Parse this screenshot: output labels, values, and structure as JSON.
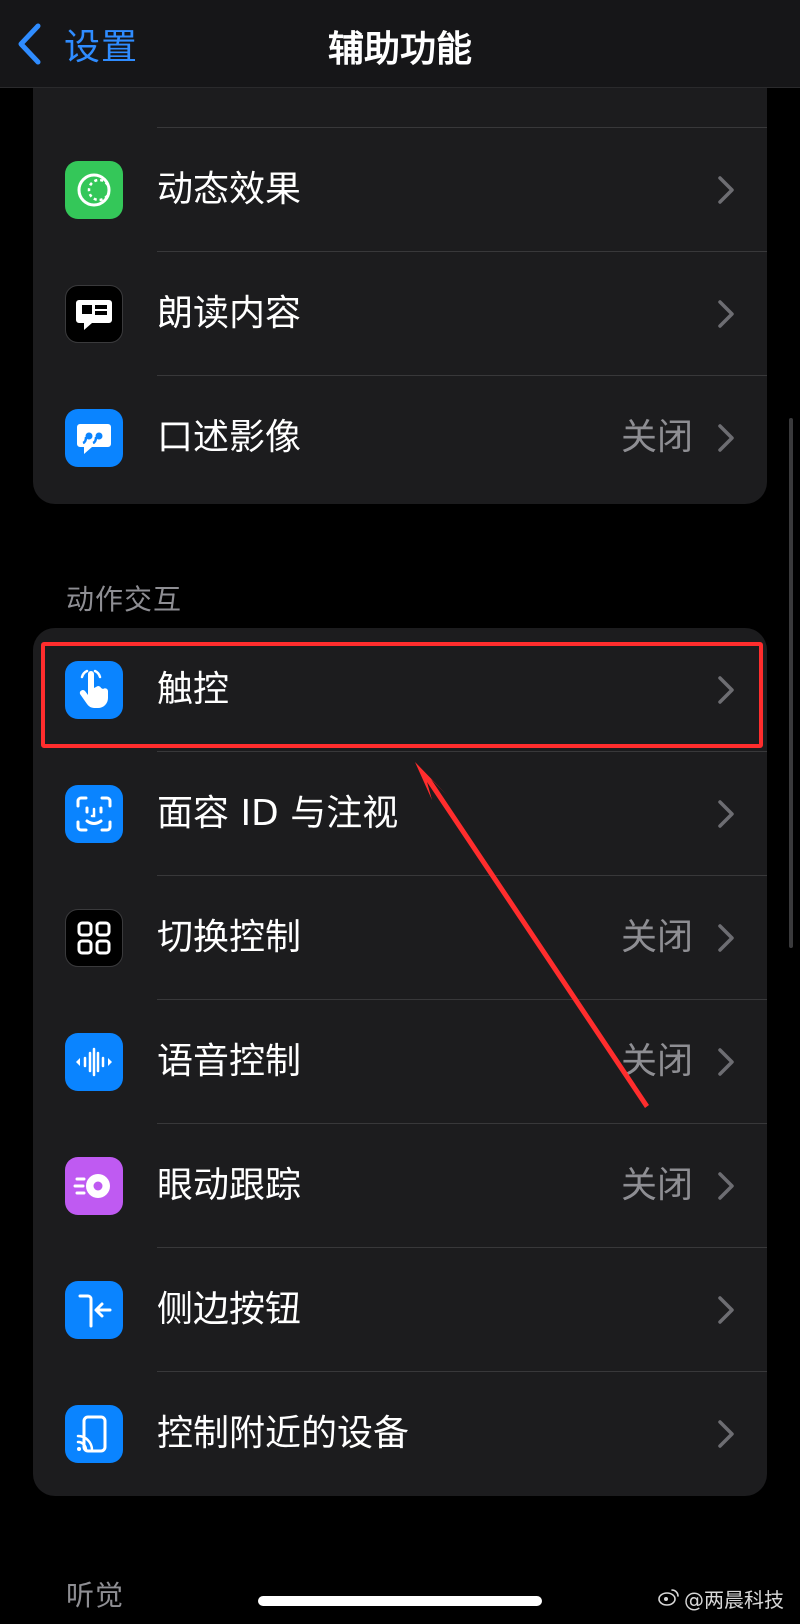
{
  "nav": {
    "back_label": "设置",
    "title": "辅助功能"
  },
  "groups": {
    "top": {
      "items": [
        {
          "label": "动态效果",
          "value": "",
          "icon": "motion-icon",
          "icon_color": "#34c759"
        },
        {
          "label": "朗读内容",
          "value": "",
          "icon": "spoken-content-icon",
          "icon_color": "#000000"
        },
        {
          "label": "口述影像",
          "value": "关闭",
          "icon": "audio-descriptions-icon",
          "icon_color": "#0a84ff"
        }
      ]
    },
    "motor": {
      "header": "动作交互",
      "items": [
        {
          "label": "触控",
          "value": "",
          "icon": "touch-hand-icon",
          "icon_color": "#0a84ff"
        },
        {
          "label": "面容 ID 与注视",
          "value": "",
          "icon": "face-id-icon",
          "icon_color": "#0a84ff"
        },
        {
          "label": "切换控制",
          "value": "关闭",
          "icon": "switch-control-icon",
          "icon_color": "#000000"
        },
        {
          "label": "语音控制",
          "value": "关闭",
          "icon": "voice-control-icon",
          "icon_color": "#0a84ff"
        },
        {
          "label": "眼动跟踪",
          "value": "关闭",
          "icon": "eye-tracking-icon",
          "icon_color": "#bf5af2"
        },
        {
          "label": "侧边按钮",
          "value": "",
          "icon": "side-button-icon",
          "icon_color": "#0a84ff"
        },
        {
          "label": "控制附近的设备",
          "value": "",
          "icon": "nearby-devices-icon",
          "icon_color": "#0a84ff"
        }
      ]
    },
    "hearing": {
      "header": "听觉"
    }
  },
  "annotation": {
    "color": "#ff2d2d"
  },
  "watermark": {
    "text": "@两晨科技"
  }
}
